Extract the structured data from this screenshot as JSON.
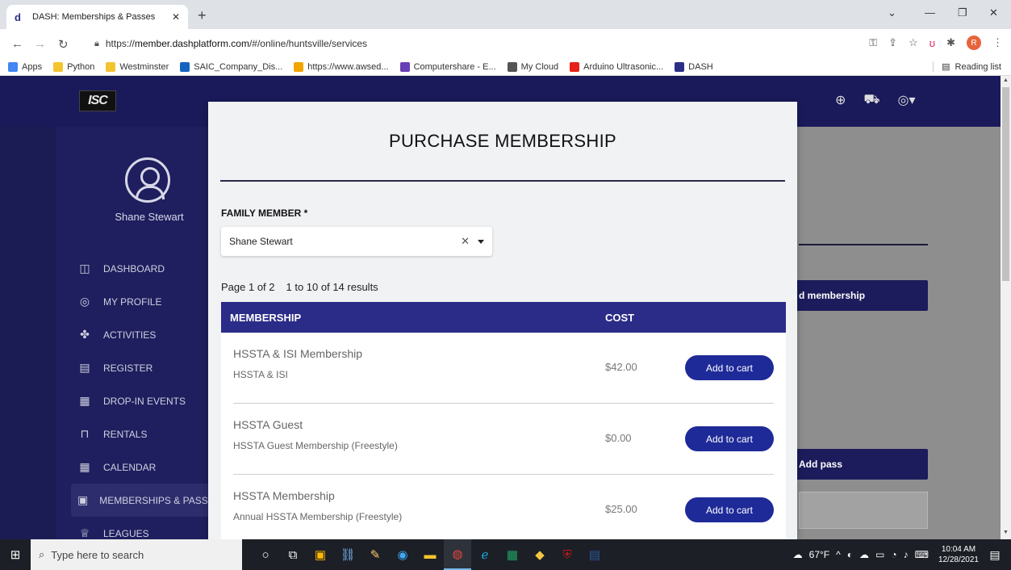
{
  "browser": {
    "tab_title": "DASH: Memberships & Passes",
    "tab_favicon": "d",
    "url_prefix": "https://",
    "url_host": "member.dashplatform.com",
    "url_path": "/#/online/huntsville/services",
    "profile_initial": "R",
    "bookmarks": [
      {
        "label": "Apps",
        "icon": "apps-grid-icon",
        "color": "#4285f4"
      },
      {
        "label": "Python",
        "icon": "folder-icon",
        "color": "#f4c430"
      },
      {
        "label": "Westminster",
        "icon": "folder-icon",
        "color": "#f4c430"
      },
      {
        "label": "SAIC_Company_Dis...",
        "icon": "saic-icon",
        "color": "#1565c0"
      },
      {
        "label": "https://www.awsed...",
        "icon": "package-icon",
        "color": "#f0a500"
      },
      {
        "label": "Computershare - E...",
        "icon": "computershare-icon",
        "color": "#6a3fb5"
      },
      {
        "label": "My Cloud",
        "icon": "cloud-icon",
        "color": "#555555"
      },
      {
        "label": "Arduino Ultrasonic...",
        "icon": "youtube-icon",
        "color": "#e62117"
      },
      {
        "label": "DASH",
        "icon": "dash-icon",
        "color": "#2b2f84"
      }
    ],
    "reading_list": "Reading list"
  },
  "sidebar": {
    "user_name": "Shane Stewart",
    "items": [
      {
        "label": "DASHBOARD",
        "icon": "dashboard-icon"
      },
      {
        "label": "MY PROFILE",
        "icon": "profile-icon"
      },
      {
        "label": "ACTIVITIES",
        "icon": "activities-icon"
      },
      {
        "label": "REGISTER",
        "icon": "register-icon"
      },
      {
        "label": "DROP-IN EVENTS",
        "icon": "calendar-icon"
      },
      {
        "label": "RENTALS",
        "icon": "bookmark-icon"
      },
      {
        "label": "CALENDAR",
        "icon": "calendar-icon"
      },
      {
        "label": "MEMBERSHIPS & PASSES",
        "icon": "membership-icon"
      },
      {
        "label": "LEAGUES",
        "icon": "trophy-icon"
      }
    ]
  },
  "background": {
    "add_membership": "d membership",
    "add_pass": "Add pass"
  },
  "modal": {
    "title": "PURCHASE MEMBERSHIP",
    "family_member_label": "FAMILY MEMBER *",
    "family_member_value": "Shane Stewart",
    "page_info": "Page 1 of 2",
    "results_info": "1 to 10 of 14 results",
    "col_membership": "MEMBERSHIP",
    "col_cost": "COST",
    "rows": [
      {
        "name": "HSSTA & ISI Membership",
        "desc": "HSSTA & ISI",
        "cost": "$42.00",
        "button": "Add to cart"
      },
      {
        "name": "HSSTA Guest",
        "desc": "HSSTA Guest Membership (Freestyle)",
        "cost": "$0.00",
        "button": "Add to cart"
      },
      {
        "name": "HSSTA Membership",
        "desc": "Annual HSSTA Membership (Freestyle)",
        "cost": "$25.00",
        "button": "Add to cart"
      }
    ]
  },
  "taskbar": {
    "search_placeholder": "Type here to search",
    "weather": "67°F",
    "time": "10:04 AM",
    "date": "12/28/2021"
  },
  "colors": {
    "topbar": "#1a1a5a",
    "sidebar": "#1f1f5f",
    "table_header": "#2b2b88",
    "add_button": "#1f2a99"
  }
}
